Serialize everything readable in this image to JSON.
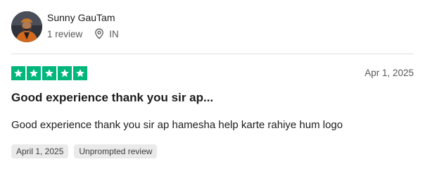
{
  "reviewer": {
    "name": "Sunny GauTam",
    "review_count": "1 review",
    "country": "IN",
    "avatar_icon": "profile-photo",
    "location_icon": "map-pin-icon"
  },
  "review": {
    "rating": 5,
    "rating_max": 5,
    "star_color": "#00b67a",
    "date": "Apr 1, 2025",
    "title": "Good experience thank you sir ap...",
    "body": "Good experience thank you sir ap hamesha help karte rahiye hum logo",
    "tags": [
      {
        "label": "April 1, 2025"
      },
      {
        "label": "Unprompted review"
      }
    ]
  }
}
